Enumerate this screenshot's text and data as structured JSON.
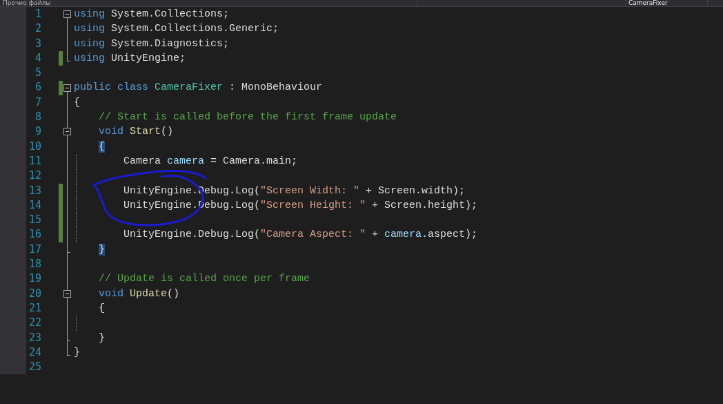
{
  "tabs": [
    {
      "label": "Прочие файлы",
      "selected": false
    },
    {
      "label": "CameraFixer",
      "selected": true
    }
  ],
  "lines": [
    {
      "number": "1",
      "kind": "fold",
      "changed": false,
      "tokens": [
        {
          "kind": "kw",
          "text": "using"
        },
        {
          "kind": "plain",
          "text": " System.Collections;"
        }
      ]
    },
    {
      "number": "2",
      "kind": "bar",
      "changed": false,
      "tokens": [
        {
          "kind": "kw",
          "text": "using"
        },
        {
          "kind": "plain",
          "text": " System.Collections.Generic;"
        }
      ]
    },
    {
      "number": "3",
      "kind": "bar",
      "changed": false,
      "tokens": [
        {
          "kind": "kw",
          "text": "using"
        },
        {
          "kind": "plain",
          "text": " System.Diagnostics;"
        }
      ]
    },
    {
      "number": "4",
      "kind": "end",
      "changed": true,
      "tokens": [
        {
          "kind": "kw",
          "text": "using"
        },
        {
          "kind": "plain",
          "text": " UnityEngine;"
        }
      ]
    },
    {
      "number": "5",
      "changed": false
    },
    {
      "number": "6",
      "kind": "fold",
      "changed": true,
      "tokens": [
        {
          "kind": "kw",
          "text": "public"
        },
        {
          "kind": "kw",
          "text": " class"
        },
        {
          "kind": "type",
          "text": " CameraFixer"
        },
        {
          "kind": "plain",
          "text": " : MonoBehaviour"
        }
      ]
    },
    {
      "number": "7",
      "kind": "bar",
      "changed": false,
      "tokens": [
        {
          "kind": "plain",
          "text": "{"
        }
      ]
    },
    {
      "number": "8",
      "kind": "bar",
      "changed": false,
      "tokens": [
        {
          "kind": "comment",
          "text": "    // Start is called before the first frame update"
        }
      ]
    },
    {
      "number": "9",
      "kind": "fold",
      "changed": false,
      "tokens": [
        {
          "kind": "kw",
          "text": "    void"
        },
        {
          "kind": "method",
          "text": " Start"
        },
        {
          "kind": "plain",
          "text": "()"
        }
      ]
    },
    {
      "number": "10",
      "kind": "bar",
      "changed": false,
      "tokens": [
        {
          "kind": "match",
          "text": "    {"
        }
      ]
    },
    {
      "number": "11",
      "kind": "bar",
      "changed": false,
      "tokens": [
        {
          "kind": "plain",
          "text": "        Camera "
        },
        {
          "kind": "local",
          "text": "camera"
        },
        {
          "kind": "plain",
          "text": " = Camera.main;"
        }
      ]
    },
    {
      "number": "12",
      "kind": "bar",
      "changed": false
    },
    {
      "number": "13",
      "kind": "bar",
      "changed": true,
      "tokens": [
        {
          "kind": "plain",
          "text": "        UnityEngine.Debug.Log("
        },
        {
          "kind": "string",
          "text": "\"Screen Width: \""
        },
        {
          "kind": "plain",
          "text": " + Screen.width);"
        }
      ]
    },
    {
      "number": "14",
      "kind": "bar",
      "changed": true,
      "tokens": [
        {
          "kind": "plain",
          "text": "        UnityEngine.Debug.Log("
        },
        {
          "kind": "string",
          "text": "\"Screen Height: \""
        },
        {
          "kind": "plain",
          "text": " + Screen.height);"
        }
      ]
    },
    {
      "number": "15",
      "kind": "bar",
      "changed": true
    },
    {
      "number": "16",
      "kind": "bar",
      "changed": true,
      "tokens": [
        {
          "kind": "plain",
          "text": "        UnityEngine.Debug.Log("
        },
        {
          "kind": "string",
          "text": "\"Camera Aspect: \""
        },
        {
          "kind": "plain",
          "text": " + "
        },
        {
          "kind": "local",
          "text": "camera"
        },
        {
          "kind": "plain",
          "text": ".aspect);"
        }
      ]
    },
    {
      "number": "17",
      "kind": "end",
      "changed": false,
      "tokens": [
        {
          "kind": "match",
          "text": "    }"
        }
      ]
    },
    {
      "number": "18",
      "kind": "bar",
      "changed": false
    },
    {
      "number": "19",
      "kind": "bar",
      "changed": false,
      "tokens": [
        {
          "kind": "comment",
          "text": "    // Update is called once per frame"
        }
      ]
    },
    {
      "number": "20",
      "kind": "fold",
      "changed": false,
      "tokens": [
        {
          "kind": "kw",
          "text": "    void"
        },
        {
          "kind": "method",
          "text": " Update"
        },
        {
          "kind": "plain",
          "text": "()"
        }
      ]
    },
    {
      "number": "21",
      "kind": "bar",
      "changed": false,
      "tokens": [
        {
          "kind": "plain",
          "text": "    {"
        }
      ]
    },
    {
      "number": "22",
      "kind": "bar",
      "changed": false
    },
    {
      "number": "23",
      "kind": "end",
      "changed": false,
      "tokens": [
        {
          "kind": "plain",
          "text": "    }"
        }
      ]
    },
    {
      "number": "24",
      "kind": "end",
      "changed": false,
      "tokens": [
        {
          "kind": "plain",
          "text": "}"
        }
      ]
    },
    {
      "number": "25",
      "changed": false
    }
  ]
}
